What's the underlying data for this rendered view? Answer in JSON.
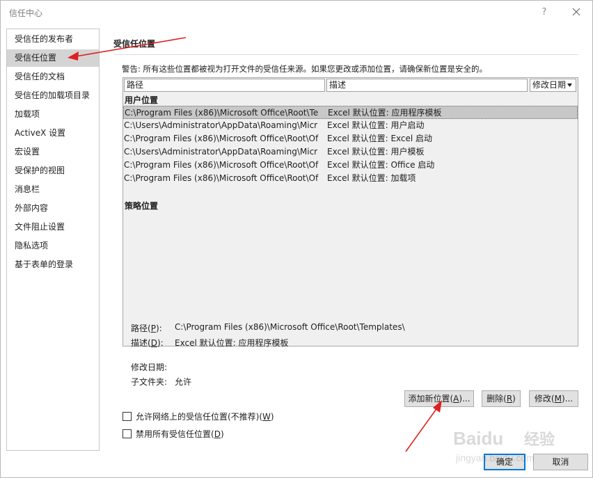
{
  "window": {
    "title": "信任中心",
    "help_label": "?"
  },
  "sidebar": {
    "items": [
      {
        "label": "受信任的发布者"
      },
      {
        "label": "受信任位置",
        "selected": true
      },
      {
        "label": "受信任的文档"
      },
      {
        "label": "受信任的加载项目录"
      },
      {
        "label": "加载项"
      },
      {
        "label": "ActiveX 设置"
      },
      {
        "label": "宏设置"
      },
      {
        "label": "受保护的视图"
      },
      {
        "label": "消息栏"
      },
      {
        "label": "外部内容"
      },
      {
        "label": "文件阻止设置"
      },
      {
        "label": "隐私选项"
      },
      {
        "label": "基于表单的登录"
      }
    ]
  },
  "main": {
    "section_title": "受信任位置",
    "warning": "警告: 所有这些位置都被视为打开文件的受信任来源。如果您更改或添加位置，请确保新位置是安全的。",
    "columns": {
      "path": "路径",
      "description": "描述",
      "date": "修改日期"
    },
    "user_group_title": "用户位置",
    "policy_group_title": "策略位置",
    "rows": [
      {
        "path": "C:\\Program Files (x86)\\Microsoft Office\\Root\\Te",
        "description": "Excel 默认位置: 应用程序模板"
      },
      {
        "path": "C:\\Users\\Administrator\\AppData\\Roaming\\Micr",
        "description": "Excel 默认位置: 用户启动"
      },
      {
        "path": "C:\\Program Files (x86)\\Microsoft Office\\Root\\Of",
        "description": "Excel 默认位置: Excel 启动"
      },
      {
        "path": "C:\\Users\\Administrator\\AppData\\Roaming\\Micr",
        "description": "Excel 默认位置: 用户模板"
      },
      {
        "path": "C:\\Program Files (x86)\\Microsoft Office\\Root\\Of",
        "description": "Excel 默认位置: Office 启动"
      },
      {
        "path": "C:\\Program Files (x86)\\Microsoft Office\\Root\\Of",
        "description": "Excel 默认位置: 加载项"
      }
    ],
    "details": {
      "path_label": "路径(",
      "path_key": "P",
      "path_suffix": "):",
      "path_value": "C:\\Program Files (x86)\\Microsoft Office\\Root\\Templates\\",
      "desc_label": "描述(",
      "desc_key": "D",
      "desc_suffix": "):",
      "desc_value": "Excel 默认位置: 应用程序模板",
      "date_label": "修改日期:",
      "subfolder_label": "子文件夹:",
      "subfolder_value": "允许"
    },
    "buttons": {
      "add_prefix": "添加新位置(",
      "add_key": "A",
      "add_suffix": ")...",
      "remove_prefix": "删除(",
      "remove_key": "R",
      "remove_suffix": ")",
      "modify_prefix": "修改(",
      "modify_key": "M",
      "modify_suffix": ")..."
    },
    "checkboxes": {
      "network_prefix": "允许网络上的受信任位置(不推荐)(",
      "network_key": "W",
      "network_suffix": ")",
      "network_checked": false,
      "disable_prefix": "禁用所有受信任位置(",
      "disable_key": "D",
      "disable_suffix": ")",
      "disable_checked": false
    }
  },
  "footer": {
    "ok_label": "确定",
    "cancel_label": "取消"
  },
  "watermark": {
    "brand": "Baidu 经验",
    "url": "jingyan.baidu.com"
  },
  "colors": {
    "annotation_arrow": "#e02020",
    "selection": "#c8c8c8",
    "sidebar_selected": "#d4d4d4"
  }
}
